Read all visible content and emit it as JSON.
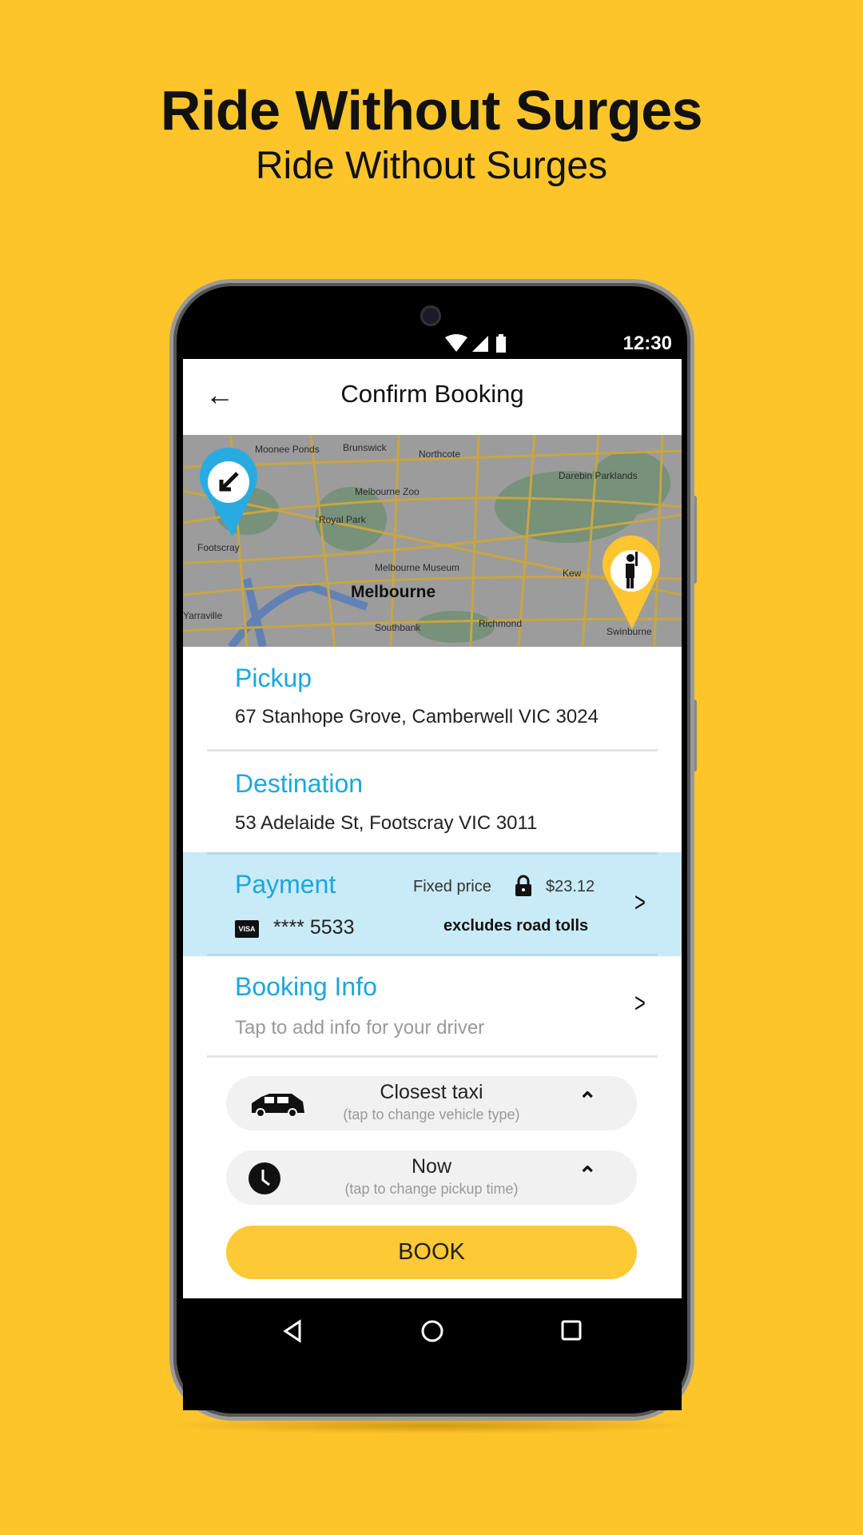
{
  "promo": {
    "headline": "Ride Without Surges",
    "subline": "Ride Without Surges"
  },
  "status_bar": {
    "time": "12:30",
    "icons": [
      "wifi-icon",
      "signal-icon",
      "battery-icon"
    ]
  },
  "app_bar": {
    "title": "Confirm Booking",
    "back_icon": "arrow-left-icon"
  },
  "map": {
    "labels": [
      "Moonee Ponds",
      "Brunswick",
      "Northcote",
      "Darebin Parklands",
      "Melbourne Zoo",
      "Royal Park",
      "Footscray",
      "Melbourne Museum",
      "Melbourne",
      "Kew",
      "Southbank",
      "Richmond",
      "Swinburne",
      "Yarraville"
    ],
    "destination_pin_color": "#29ABE2",
    "pickup_pin_color": "#FDC52F"
  },
  "pickup": {
    "label": "Pickup",
    "address": "67 Stanhope Grove, Camberwell VIC 3024"
  },
  "destination": {
    "label": "Destination",
    "address": "53 Adelaide St, Footscray VIC 3011"
  },
  "payment": {
    "label": "Payment",
    "price_type": "Fixed price",
    "price": "$23.12",
    "card_brand": "VISA",
    "card_number": "**** 5533",
    "note": "excludes road tolls"
  },
  "booking_info": {
    "label": "Booking Info",
    "hint": "Tap to add info for your driver"
  },
  "vehicle": {
    "title": "Closest taxi",
    "hint": "(tap to change vehicle type)"
  },
  "time": {
    "title": "Now",
    "hint": "(tap to change pickup time)"
  },
  "book_button": "BOOK",
  "colors": {
    "background": "#FEC52B",
    "accent": "#1AA7DF",
    "payment_bg": "#C9EAF7",
    "book_button": "#FDC935"
  }
}
